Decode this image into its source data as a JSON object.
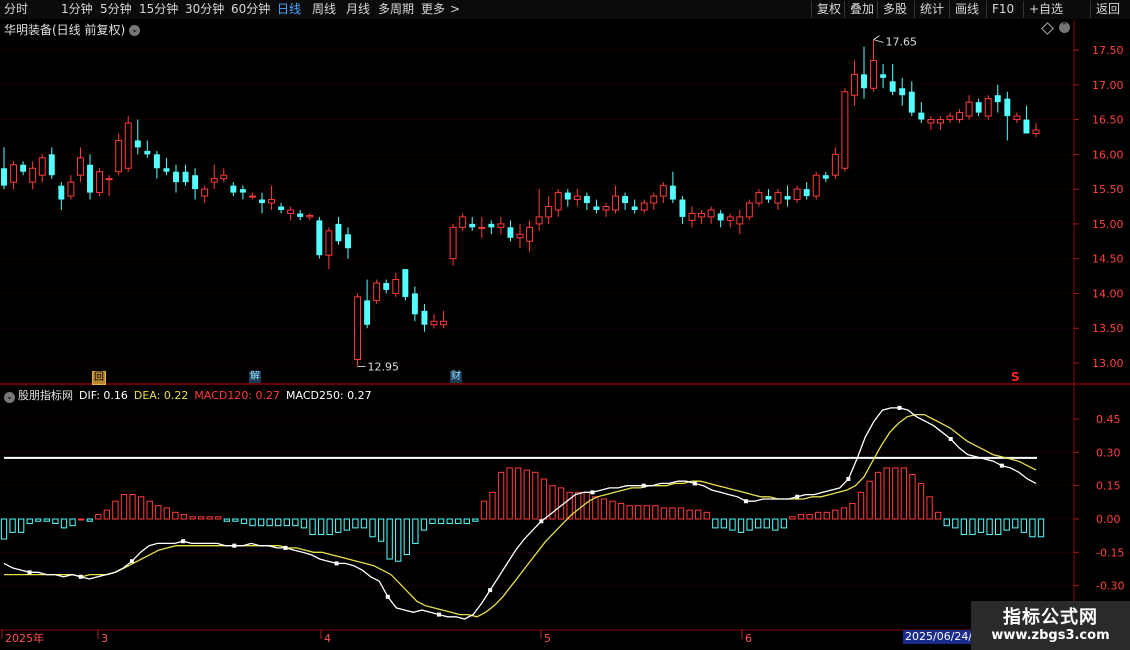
{
  "toolbar": {
    "periods": [
      "分时",
      "1分钟",
      "5分钟",
      "15分钟",
      "30分钟",
      "60分钟",
      "日线",
      "周线",
      "月线",
      "多周期",
      "更多"
    ],
    "more_arrow": ">",
    "active_period": "日线",
    "right_buttons": [
      "复权",
      "叠加",
      "多股",
      "统计",
      "画线",
      "F10",
      "+自选",
      "返回"
    ]
  },
  "main_chart": {
    "title": "华明装备(日线 前复权)",
    "high_label": "17.65",
    "low_label": "12.95",
    "markers": [
      "回",
      "解",
      "财",
      "S"
    ]
  },
  "indicator": {
    "name": "股朋指标网",
    "dif": "DIF: 0.16",
    "dea": "DEA: 0.22",
    "macd120": "MACD120: 0.27",
    "macd250": "MACD250: 0.27"
  },
  "x_axis": {
    "labels": [
      "2025年",
      "3",
      "4",
      "5",
      "6"
    ],
    "cursor_date": "2025/06/24/二"
  },
  "watermark": {
    "title": "指标公式网",
    "url": "www.zbgs3.com"
  },
  "colors": {
    "up": "#ff3b3b",
    "down": "#54ffff",
    "dif": "#ffffff",
    "dea": "#e8e04a",
    "hline": "#ffffff",
    "grid": "#5a0000"
  },
  "chart_data": [
    {
      "type": "candlestick",
      "title": "华明装备(日线 前复权)",
      "ylim": [
        12.85,
        17.9
      ],
      "yticks": [
        13.0,
        13.5,
        14.0,
        14.5,
        15.0,
        15.5,
        16.0,
        16.5,
        17.0,
        17.5
      ],
      "annotations": {
        "max": 17.65,
        "min": 12.95
      },
      "ohlc": [
        [
          15.8,
          16.1,
          15.5,
          15.55
        ],
        [
          15.6,
          15.9,
          15.5,
          15.85
        ],
        [
          15.85,
          15.9,
          15.7,
          15.75
        ],
        [
          15.6,
          15.9,
          15.5,
          15.8
        ],
        [
          15.7,
          16.0,
          15.6,
          15.95
        ],
        [
          16.0,
          16.1,
          15.65,
          15.7
        ],
        [
          15.55,
          15.6,
          15.2,
          15.35
        ],
        [
          15.4,
          15.7,
          15.35,
          15.6
        ],
        [
          15.7,
          16.1,
          15.6,
          15.95
        ],
        [
          15.85,
          16.0,
          15.35,
          15.45
        ],
        [
          15.45,
          15.8,
          15.4,
          15.75
        ],
        [
          15.65,
          15.7,
          15.4,
          15.65
        ],
        [
          15.75,
          16.3,
          15.7,
          16.2
        ],
        [
          15.8,
          16.55,
          15.75,
          16.45
        ],
        [
          16.2,
          16.5,
          16.0,
          16.1
        ],
        [
          16.05,
          16.2,
          15.95,
          16.0
        ],
        [
          16.0,
          16.05,
          15.65,
          15.8
        ],
        [
          15.8,
          15.95,
          15.7,
          15.75
        ],
        [
          15.75,
          15.85,
          15.45,
          15.6
        ],
        [
          15.75,
          15.85,
          15.55,
          15.6
        ],
        [
          15.7,
          15.8,
          15.35,
          15.5
        ],
        [
          15.4,
          15.55,
          15.3,
          15.5
        ],
        [
          15.6,
          15.85,
          15.5,
          15.65
        ],
        [
          15.65,
          15.8,
          15.6,
          15.7
        ],
        [
          15.55,
          15.6,
          15.4,
          15.45
        ],
        [
          15.5,
          15.55,
          15.35,
          15.45
        ],
        [
          15.4,
          15.45,
          15.35,
          15.4
        ],
        [
          15.35,
          15.45,
          15.15,
          15.3
        ],
        [
          15.3,
          15.55,
          15.2,
          15.35
        ],
        [
          15.25,
          15.3,
          15.15,
          15.2
        ],
        [
          15.15,
          15.25,
          15.05,
          15.2
        ],
        [
          15.15,
          15.2,
          15.05,
          15.1
        ],
        [
          15.1,
          15.15,
          15.05,
          15.12
        ],
        [
          15.05,
          15.1,
          14.5,
          14.55
        ],
        [
          14.55,
          14.95,
          14.35,
          14.9
        ],
        [
          15.0,
          15.1,
          14.7,
          14.75
        ],
        [
          14.85,
          14.95,
          14.5,
          14.65
        ],
        [
          13.05,
          14.0,
          12.95,
          13.95
        ],
        [
          13.9,
          14.2,
          13.5,
          13.55
        ],
        [
          13.9,
          14.2,
          13.85,
          14.15
        ],
        [
          14.15,
          14.2,
          14.0,
          14.05
        ],
        [
          14.0,
          14.3,
          13.95,
          14.2
        ],
        [
          14.35,
          14.35,
          13.9,
          13.95
        ],
        [
          14.0,
          14.1,
          13.6,
          13.7
        ],
        [
          13.75,
          13.85,
          13.45,
          13.55
        ],
        [
          13.55,
          13.7,
          13.5,
          13.6
        ],
        [
          13.55,
          13.75,
          13.5,
          13.6
        ],
        [
          14.5,
          15.0,
          14.4,
          14.95
        ],
        [
          14.95,
          15.15,
          14.9,
          15.1
        ],
        [
          15.0,
          15.1,
          14.9,
          14.95
        ],
        [
          14.95,
          15.1,
          14.8,
          14.95
        ],
        [
          15.0,
          15.05,
          14.85,
          14.95
        ],
        [
          14.95,
          15.1,
          14.85,
          15.0
        ],
        [
          14.95,
          15.05,
          14.75,
          14.8
        ],
        [
          14.8,
          15.0,
          14.65,
          14.85
        ],
        [
          14.75,
          15.05,
          14.6,
          14.95
        ],
        [
          15.0,
          15.5,
          14.9,
          15.1
        ],
        [
          15.1,
          15.4,
          15.0,
          15.25
        ],
        [
          15.2,
          15.5,
          15.1,
          15.45
        ],
        [
          15.45,
          15.5,
          15.25,
          15.35
        ],
        [
          15.35,
          15.5,
          15.25,
          15.4
        ],
        [
          15.4,
          15.45,
          15.2,
          15.3
        ],
        [
          15.25,
          15.35,
          15.15,
          15.2
        ],
        [
          15.2,
          15.3,
          15.1,
          15.25
        ],
        [
          15.2,
          15.55,
          15.15,
          15.4
        ],
        [
          15.4,
          15.45,
          15.2,
          15.3
        ],
        [
          15.25,
          15.35,
          15.15,
          15.2
        ],
        [
          15.2,
          15.35,
          15.15,
          15.3
        ],
        [
          15.3,
          15.45,
          15.2,
          15.4
        ],
        [
          15.4,
          15.6,
          15.3,
          15.55
        ],
        [
          15.55,
          15.75,
          15.3,
          15.35
        ],
        [
          15.35,
          15.4,
          15.0,
          15.1
        ],
        [
          15.05,
          15.25,
          14.95,
          15.15
        ],
        [
          15.1,
          15.2,
          15.0,
          15.15
        ],
        [
          15.1,
          15.25,
          15.0,
          15.2
        ],
        [
          15.15,
          15.2,
          14.95,
          15.05
        ],
        [
          15.05,
          15.15,
          14.95,
          15.1
        ],
        [
          15.0,
          15.2,
          14.85,
          15.1
        ],
        [
          15.1,
          15.35,
          15.05,
          15.3
        ],
        [
          15.3,
          15.5,
          15.25,
          15.45
        ],
        [
          15.4,
          15.5,
          15.3,
          15.35
        ],
        [
          15.3,
          15.5,
          15.2,
          15.45
        ],
        [
          15.4,
          15.55,
          15.25,
          15.35
        ],
        [
          15.35,
          15.55,
          15.3,
          15.5
        ],
        [
          15.5,
          15.6,
          15.35,
          15.4
        ],
        [
          15.4,
          15.75,
          15.35,
          15.7
        ],
        [
          15.7,
          15.75,
          15.6,
          15.65
        ],
        [
          15.7,
          16.1,
          15.65,
          16.0
        ],
        [
          15.8,
          16.95,
          15.75,
          16.9
        ],
        [
          16.85,
          17.35,
          16.7,
          17.15
        ],
        [
          17.15,
          17.55,
          16.8,
          16.95
        ],
        [
          16.95,
          17.65,
          16.9,
          17.35
        ],
        [
          17.15,
          17.3,
          16.95,
          17.1
        ],
        [
          17.05,
          17.3,
          16.85,
          16.9
        ],
        [
          16.95,
          17.1,
          16.7,
          16.85
        ],
        [
          16.9,
          17.05,
          16.55,
          16.6
        ],
        [
          16.6,
          16.75,
          16.45,
          16.5
        ],
        [
          16.45,
          16.55,
          16.35,
          16.5
        ],
        [
          16.45,
          16.55,
          16.35,
          16.5
        ],
        [
          16.5,
          16.6,
          16.45,
          16.55
        ],
        [
          16.5,
          16.65,
          16.45,
          16.6
        ],
        [
          16.55,
          16.85,
          16.5,
          16.75
        ],
        [
          16.75,
          16.8,
          16.55,
          16.6
        ],
        [
          16.55,
          16.85,
          16.5,
          16.8
        ],
        [
          16.85,
          17.0,
          16.6,
          16.75
        ],
        [
          16.8,
          16.9,
          16.2,
          16.55
        ],
        [
          16.5,
          16.6,
          16.45,
          16.55
        ],
        [
          16.5,
          16.7,
          16.3,
          16.3
        ],
        [
          16.3,
          16.45,
          16.25,
          16.35
        ]
      ]
    },
    {
      "type": "macd",
      "title": "股朋指标网",
      "ylim": [
        -0.42,
        0.6
      ],
      "yticks": [
        0.45,
        0.3,
        0.15,
        0.0,
        -0.15,
        -0.3
      ],
      "hline": 0.275,
      "series": [
        {
          "name": "DIF",
          "values": [
            -0.2,
            -0.22,
            -0.23,
            -0.24,
            -0.24,
            -0.25,
            -0.25,
            -0.26,
            -0.25,
            -0.26,
            -0.27,
            -0.26,
            -0.25,
            -0.24,
            -0.22,
            -0.19,
            -0.15,
            -0.12,
            -0.11,
            -0.11,
            -0.11,
            -0.1,
            -0.11,
            -0.11,
            -0.11,
            -0.11,
            -0.12,
            -0.12,
            -0.12,
            -0.11,
            -0.12,
            -0.12,
            -0.13,
            -0.13,
            -0.14,
            -0.15,
            -0.16,
            -0.18,
            -0.19,
            -0.2,
            -0.2,
            -0.21,
            -0.23,
            -0.26,
            -0.28,
            -0.35,
            -0.4,
            -0.41,
            -0.42,
            -0.41,
            -0.42,
            -0.43,
            -0.44,
            -0.44,
            -0.45,
            -0.43,
            -0.38,
            -0.32,
            -0.26,
            -0.2,
            -0.14,
            -0.09,
            -0.05,
            -0.01,
            0.02,
            0.05,
            0.08,
            0.11,
            0.12,
            0.12,
            0.13,
            0.14,
            0.14,
            0.15,
            0.15,
            0.15,
            0.15,
            0.16,
            0.16,
            0.17,
            0.17,
            0.16,
            0.15,
            0.13,
            0.12,
            0.11,
            0.1,
            0.08,
            0.08,
            0.09,
            0.09,
            0.09,
            0.09,
            0.1,
            0.11,
            0.11,
            0.12,
            0.13,
            0.14,
            0.18,
            0.27,
            0.37,
            0.44,
            0.49,
            0.5,
            0.5,
            0.49,
            0.46,
            0.44,
            0.42,
            0.39,
            0.36,
            0.32,
            0.29,
            0.28,
            0.27,
            0.26,
            0.24,
            0.23,
            0.21,
            0.18,
            0.16
          ]
        },
        {
          "name": "DEA",
          "values": [
            -0.25,
            -0.25,
            -0.25,
            -0.25,
            -0.25,
            -0.25,
            -0.25,
            -0.25,
            -0.25,
            -0.26,
            -0.25,
            -0.25,
            -0.25,
            -0.24,
            -0.22,
            -0.2,
            -0.18,
            -0.16,
            -0.14,
            -0.13,
            -0.12,
            -0.12,
            -0.12,
            -0.12,
            -0.12,
            -0.12,
            -0.12,
            -0.12,
            -0.12,
            -0.12,
            -0.12,
            -0.12,
            -0.12,
            -0.13,
            -0.13,
            -0.14,
            -0.15,
            -0.15,
            -0.16,
            -0.17,
            -0.18,
            -0.19,
            -0.2,
            -0.21,
            -0.23,
            -0.25,
            -0.29,
            -0.33,
            -0.37,
            -0.39,
            -0.4,
            -0.41,
            -0.42,
            -0.43,
            -0.43,
            -0.44,
            -0.42,
            -0.39,
            -0.35,
            -0.3,
            -0.25,
            -0.2,
            -0.15,
            -0.1,
            -0.06,
            -0.02,
            0.02,
            0.05,
            0.08,
            0.1,
            0.11,
            0.12,
            0.13,
            0.14,
            0.14,
            0.15,
            0.15,
            0.15,
            0.16,
            0.16,
            0.17,
            0.17,
            0.16,
            0.15,
            0.14,
            0.13,
            0.12,
            0.11,
            0.1,
            0.1,
            0.09,
            0.09,
            0.09,
            0.09,
            0.1,
            0.1,
            0.11,
            0.12,
            0.13,
            0.15,
            0.19,
            0.26,
            0.33,
            0.39,
            0.43,
            0.46,
            0.47,
            0.47,
            0.45,
            0.43,
            0.41,
            0.38,
            0.35,
            0.33,
            0.31,
            0.29,
            0.28,
            0.27,
            0.26,
            0.24,
            0.22
          ]
        },
        {
          "name": "MACD",
          "values": [
            -0.09,
            -0.06,
            -0.06,
            -0.02,
            -0.01,
            -0.01,
            -0.02,
            -0.04,
            -0.03,
            0.0,
            -0.01,
            0.02,
            0.04,
            0.08,
            0.11,
            0.11,
            0.1,
            0.08,
            0.06,
            0.05,
            0.03,
            0.02,
            0.01,
            0.01,
            0.01,
            0.01,
            -0.01,
            -0.01,
            -0.02,
            -0.03,
            -0.03,
            -0.03,
            -0.03,
            -0.03,
            -0.03,
            -0.04,
            -0.07,
            -0.07,
            -0.07,
            -0.06,
            -0.05,
            -0.04,
            -0.04,
            -0.08,
            -0.1,
            -0.18,
            -0.19,
            -0.16,
            -0.11,
            -0.05,
            -0.02,
            -0.02,
            -0.02,
            -0.02,
            -0.02,
            -0.01,
            0.08,
            0.12,
            0.21,
            0.23,
            0.23,
            0.22,
            0.21,
            0.18,
            0.15,
            0.14,
            0.12,
            0.12,
            0.12,
            0.1,
            0.09,
            0.08,
            0.07,
            0.06,
            0.06,
            0.06,
            0.06,
            0.05,
            0.05,
            0.05,
            0.04,
            0.04,
            0.03,
            -0.04,
            -0.04,
            -0.05,
            -0.06,
            -0.05,
            -0.04,
            -0.04,
            -0.05,
            -0.04,
            0.01,
            0.02,
            0.02,
            0.03,
            0.03,
            0.04,
            0.05,
            0.07,
            0.12,
            0.17,
            0.21,
            0.23,
            0.23,
            0.23,
            0.2,
            0.16,
            0.1,
            0.03,
            -0.03,
            -0.04,
            -0.07,
            -0.07,
            -0.06,
            -0.07,
            -0.07,
            -0.05,
            -0.04,
            -0.06,
            -0.08,
            -0.08
          ]
        }
      ]
    }
  ]
}
